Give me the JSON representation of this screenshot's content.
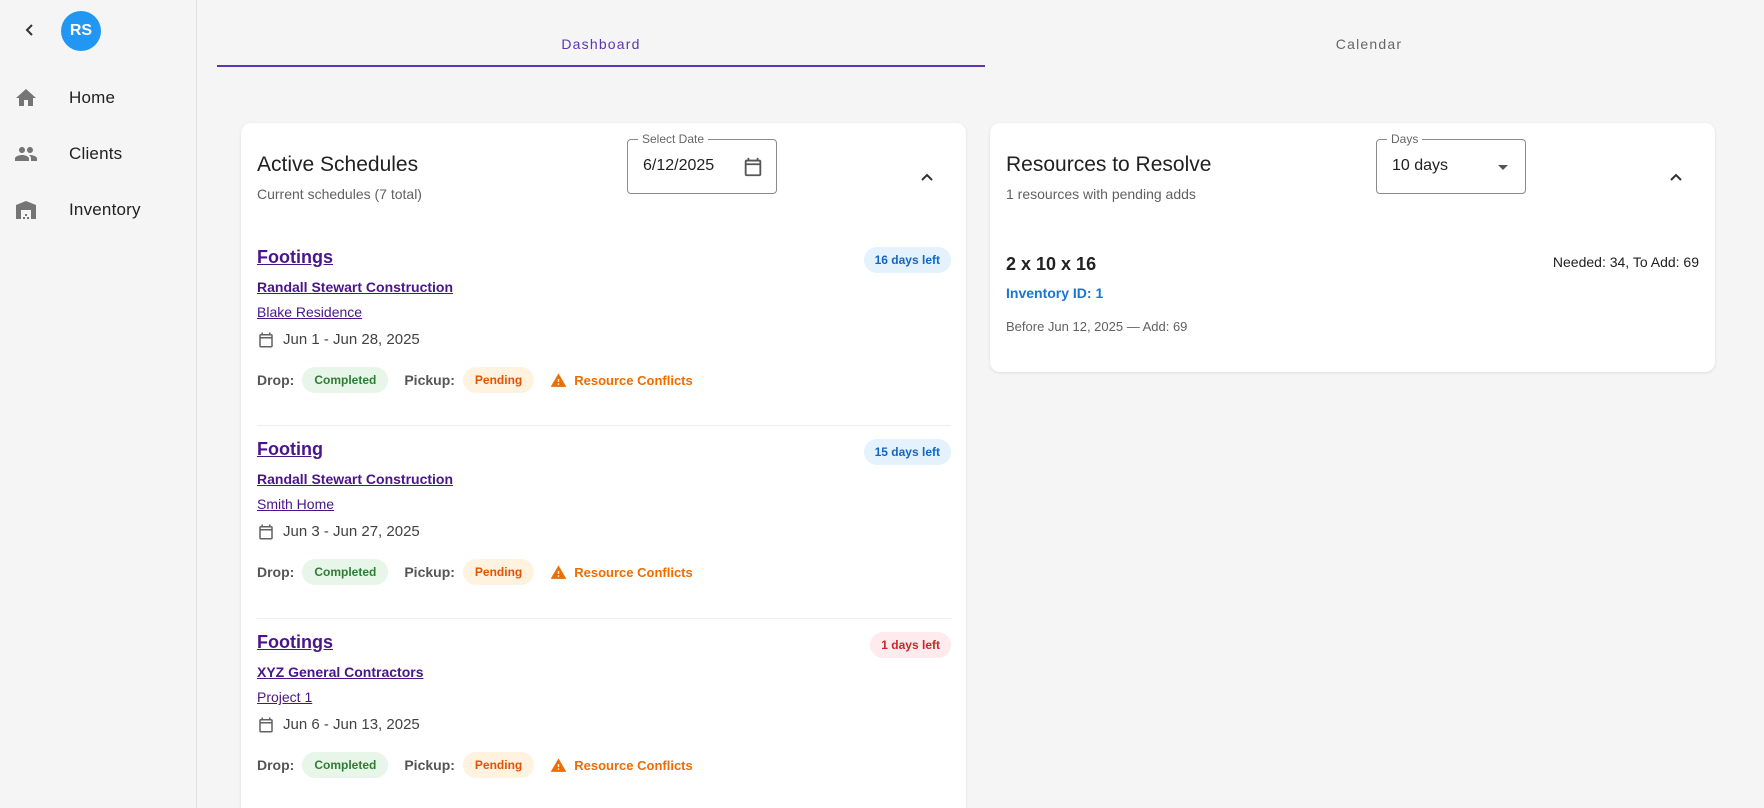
{
  "sidebar": {
    "avatar_initials": "RS",
    "avatar_color": "#2196f3",
    "items": [
      {
        "label": "Home",
        "icon": "home-icon"
      },
      {
        "label": "Clients",
        "icon": "people-icon"
      },
      {
        "label": "Inventory",
        "icon": "warehouse-icon"
      }
    ]
  },
  "tabs": [
    {
      "label": "Dashboard",
      "active": true
    },
    {
      "label": "Calendar",
      "active": false
    }
  ],
  "accent_color": "#5e35b1",
  "active_schedules": {
    "title": "Active Schedules",
    "subtitle": "Current schedules (7 total)",
    "date_field": {
      "label": "Select Date",
      "value": "6/12/2025"
    },
    "items": [
      {
        "title": "Footings",
        "client": "Randall Stewart Construction",
        "site": "Blake Residence",
        "dates": "Jun 1 - Jun 28, 2025",
        "days_left": "16 days left",
        "days_left_style": "blue",
        "drop_label": "Drop:",
        "drop_status": "Completed",
        "pickup_label": "Pickup:",
        "pickup_status": "Pending",
        "conflict": "Resource Conflicts"
      },
      {
        "title": "Footing",
        "client": "Randall Stewart Construction",
        "site": "Smith Home",
        "dates": "Jun 3 - Jun 27, 2025",
        "days_left": "15 days left",
        "days_left_style": "blue",
        "drop_label": "Drop:",
        "drop_status": "Completed",
        "pickup_label": "Pickup:",
        "pickup_status": "Pending",
        "conflict": "Resource Conflicts"
      },
      {
        "title": "Footings",
        "client": "XYZ General Contractors",
        "site": "Project 1",
        "dates": "Jun 6 - Jun 13, 2025",
        "days_left": "1 days left",
        "days_left_style": "red",
        "drop_label": "Drop:",
        "drop_status": "Completed",
        "pickup_label": "Pickup:",
        "pickup_status": "Pending",
        "conflict": "Resource Conflicts"
      }
    ]
  },
  "resources": {
    "title": "Resources to Resolve",
    "subtitle": "1 resources with pending adds",
    "days_field": {
      "label": "Days",
      "value": "10 days"
    },
    "items": [
      {
        "name": "2 x 10 x 16",
        "inventory_id": "Inventory ID: 1",
        "needed": "Needed: 34, To Add: 69",
        "before": "Before Jun 12, 2025 — Add: 69"
      }
    ]
  }
}
